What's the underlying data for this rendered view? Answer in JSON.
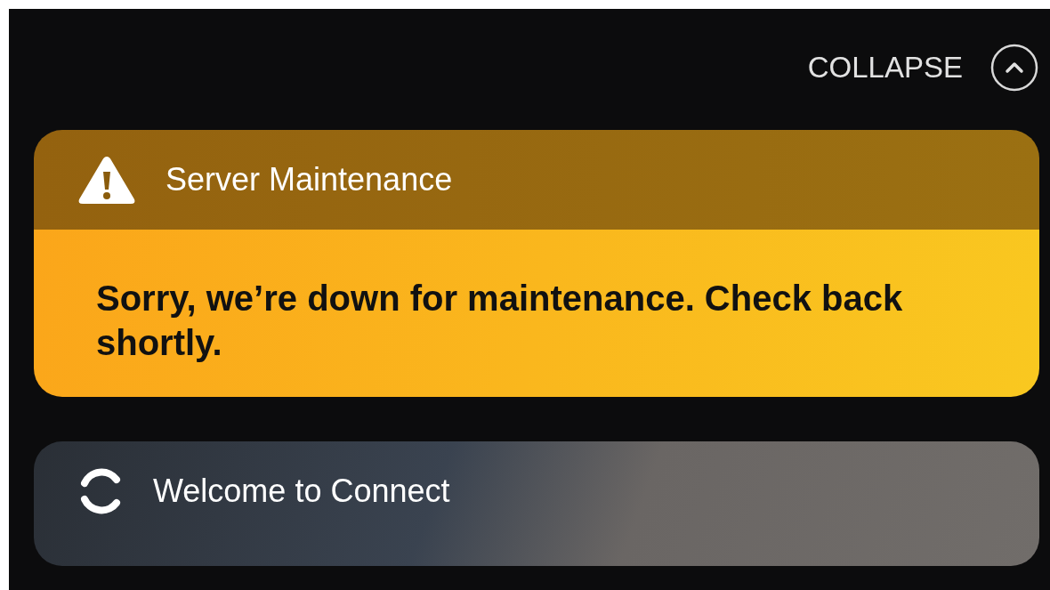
{
  "collapse_button": {
    "label": "COLLAPSE"
  },
  "notifications": [
    {
      "kind": "warning",
      "title": "Server Maintenance",
      "message": "Sorry, we’re down for maintenance. Check back shortly."
    },
    {
      "kind": "sync",
      "title": "Welcome to Connect"
    }
  ]
}
